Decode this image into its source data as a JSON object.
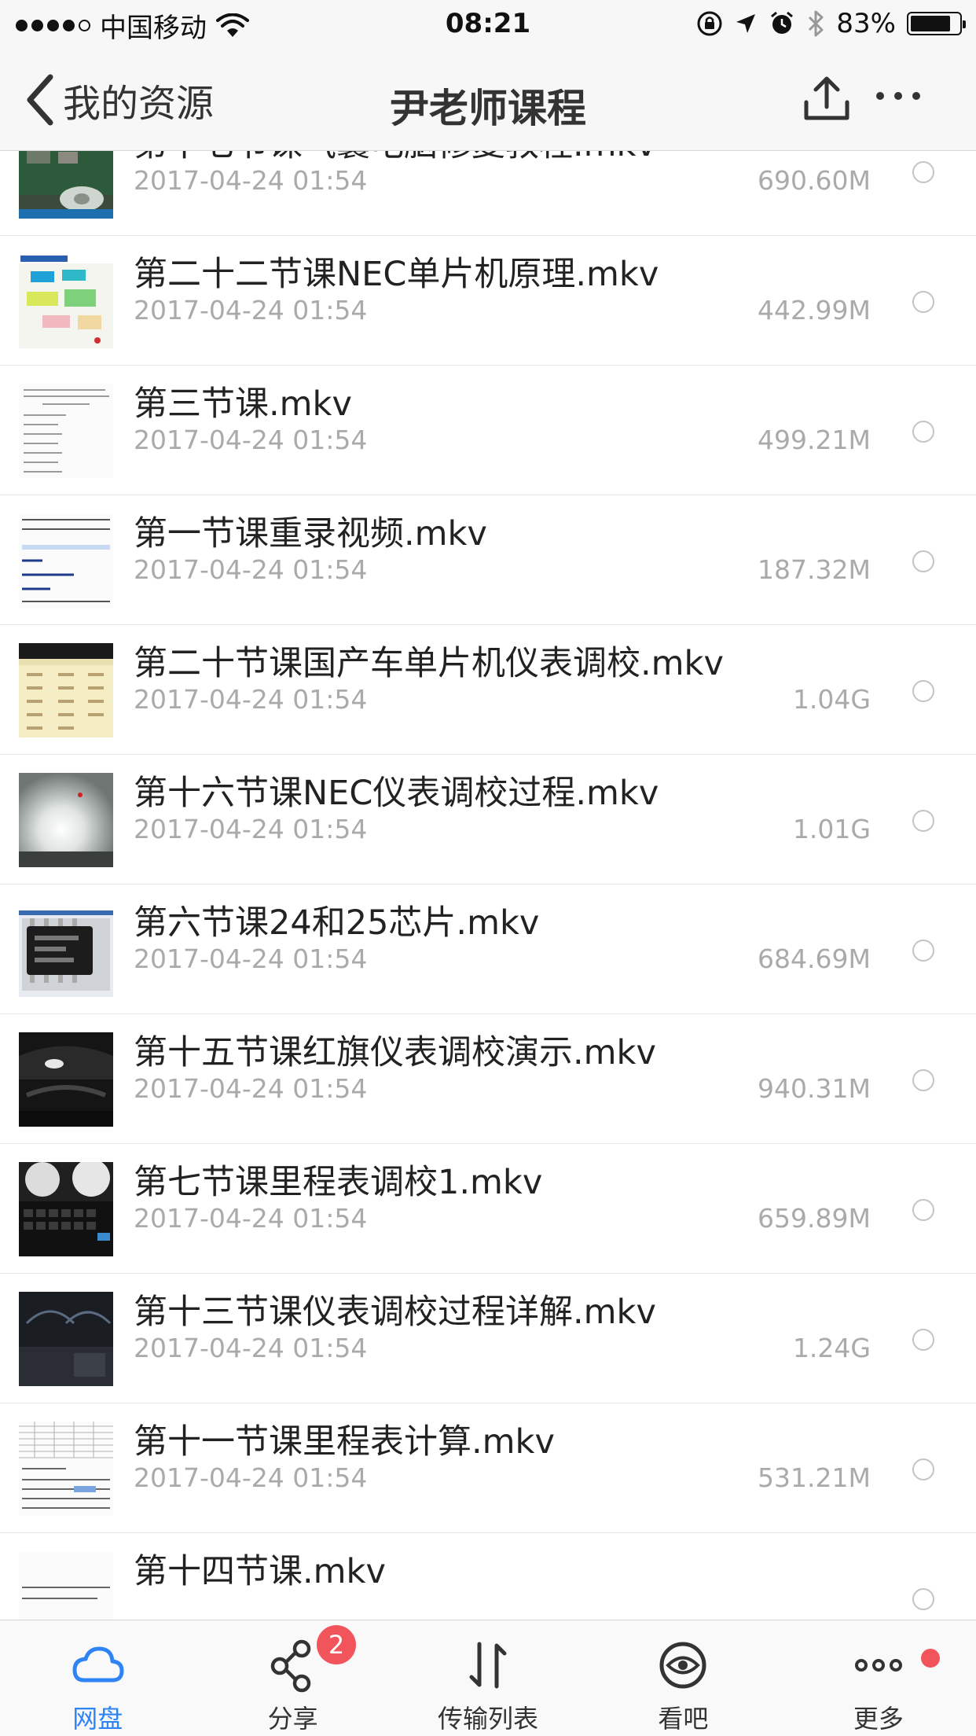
{
  "status_bar": {
    "carrier": "中国移动",
    "time": "08:21",
    "battery_percent": "83%",
    "battery_level": 0.83
  },
  "nav": {
    "back_label": "我的资源",
    "title": "尹老师课程"
  },
  "files": [
    {
      "name": "第十七节课气囊电脑修复教程.mkv",
      "date": "2017-04-24 01:54",
      "size": "690.60M",
      "thumb": "board-photo"
    },
    {
      "name": "第二十二节课NEC单片机原理.mkv",
      "date": "2017-04-24 01:54",
      "size": "442.99M",
      "thumb": "nec-slide"
    },
    {
      "name": "第三节课.mkv",
      "date": "2017-04-24 01:54",
      "size": "499.21M",
      "thumb": "text-doc"
    },
    {
      "name": "第一节课重录视频.mkv",
      "date": "2017-04-24 01:54",
      "size": "187.32M",
      "thumb": "text-doc-blue"
    },
    {
      "name": "第二十节课国产车单片机仪表调校.mkv",
      "date": "2017-04-24 01:54",
      "size": "1.04G",
      "thumb": "yellow-table"
    },
    {
      "name": "第十六节课NEC仪表调校过程.mkv",
      "date": "2017-04-24 01:54",
      "size": "1.01G",
      "thumb": "glare-photo"
    },
    {
      "name": "第六节课24和25芯片.mkv",
      "date": "2017-04-24 01:54",
      "size": "684.69M",
      "thumb": "chip-photo"
    },
    {
      "name": "第十五节课红旗仪表调校演示.mkv",
      "date": "2017-04-24 01:54",
      "size": "940.31M",
      "thumb": "dark-dashboard"
    },
    {
      "name": "第七节课里程表调校1.mkv",
      "date": "2017-04-24 01:54",
      "size": "659.89M",
      "thumb": "keyboard-photo"
    },
    {
      "name": "第十三节课仪表调校过程详解.mkv",
      "date": "2017-04-24 01:54",
      "size": "1.24G",
      "thumb": "dark-cluster"
    },
    {
      "name": "第十一节课里程表计算.mkv",
      "date": "2017-04-24 01:54",
      "size": "531.21M",
      "thumb": "grid-table"
    },
    {
      "name": "第十四节课.mkv",
      "date": "",
      "size": "",
      "thumb": "text-doc"
    }
  ],
  "tabs": [
    {
      "label": "网盘",
      "icon": "cloud-icon",
      "active": true
    },
    {
      "label": "分享",
      "icon": "share-icon",
      "active": false
    },
    {
      "label": "传输列表",
      "icon": "transfer-icon",
      "active": false
    },
    {
      "label": "看吧",
      "icon": "eye-icon",
      "active": false
    },
    {
      "label": "更多",
      "icon": "more-icon",
      "active": false
    }
  ],
  "share_badge": "2",
  "colors": {
    "accent": "#2f84f5",
    "badge": "#f2545b",
    "meta_text": "#aaaaaa"
  }
}
